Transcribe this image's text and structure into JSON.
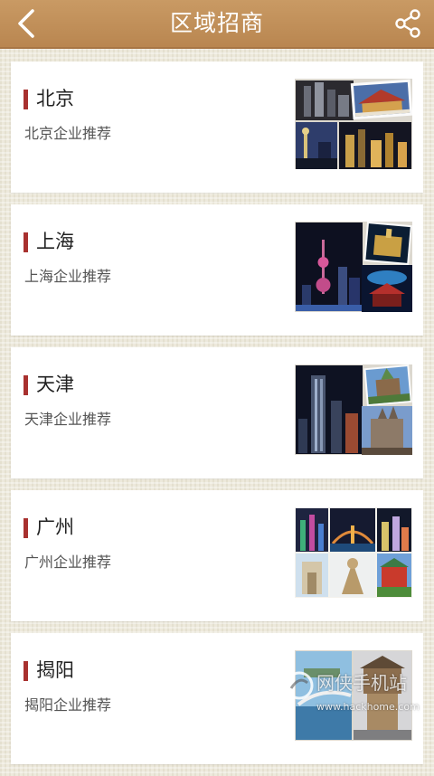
{
  "header": {
    "title": "区域招商",
    "back_icon": "chevron-left-icon",
    "share_icon": "share-icon"
  },
  "cards": [
    {
      "title": "北京",
      "subtitle": "北京企业推荐"
    },
    {
      "title": "上海",
      "subtitle": "上海企业推荐"
    },
    {
      "title": "天津",
      "subtitle": "天津企业推荐"
    },
    {
      "title": "广州",
      "subtitle": "广州企业推荐"
    },
    {
      "title": "揭阳",
      "subtitle": "揭阳企业推荐"
    }
  ],
  "watermark": {
    "text": "网侠手机站",
    "url": "www.hackhome.com"
  },
  "colors": {
    "header": "#bf8d58",
    "accent_bar": "#a8312f",
    "background": "#ede9dc"
  }
}
